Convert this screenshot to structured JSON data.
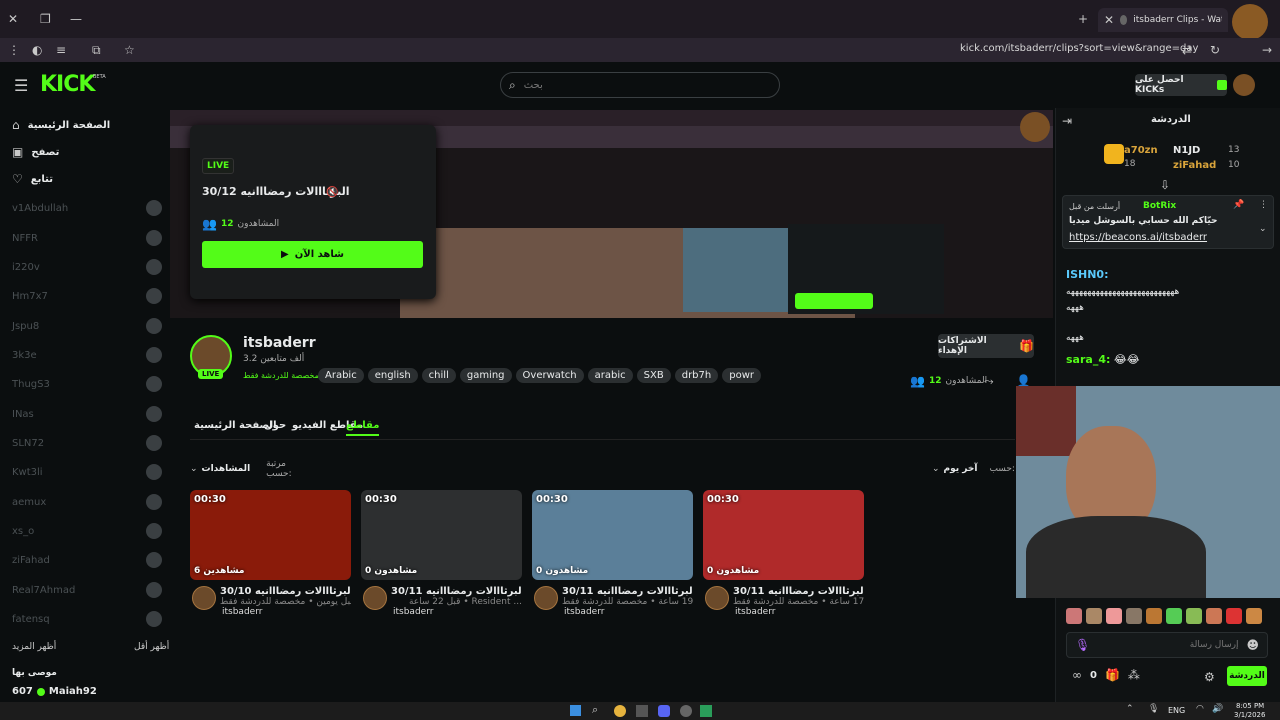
{
  "browser": {
    "tab_title": "itsbaderr Clips - Watch Live",
    "url": "kick.com/itsbaderr/clips?sort=view&range=day"
  },
  "header": {
    "logo": "KICK",
    "beta": "BETA",
    "search_placeholder": "بحث",
    "get_kicks": "احصل على KICKs"
  },
  "sidebar": {
    "nav": [
      {
        "label": "الصفحة الرئيسية",
        "icon": "home-icon"
      },
      {
        "label": "تصفح",
        "icon": "browse-icon"
      },
      {
        "label": "تتابع",
        "icon": "heart-icon"
      }
    ],
    "channels": [
      "v1Abdullah",
      "NFFR",
      "i220v",
      "Hm7x7",
      "Jspu8",
      "3k3e",
      "ThugS3",
      "INas",
      "SLN72",
      "Kwt3li",
      "aemux",
      "xs_o",
      "ziFahad",
      "Real7Ahmad",
      "fatensq"
    ],
    "show_more": "أظهر المزيد",
    "show_less": "أظهر أقل",
    "recommended_title": "موصى بها",
    "recommended_item": {
      "count": "607",
      "name": "Maiah92"
    }
  },
  "popup": {
    "live": "LIVE",
    "title": "البرثااالات رمضااانيه 30/12",
    "viewers_label": "المشاهدون",
    "viewers": "12",
    "watch_now": "شاهد الآن"
  },
  "channel": {
    "name": "itsbaderr",
    "followers": "3.2 ألف متابعين",
    "chat_only": "مخصصة للدردشة فقط",
    "live": "LIVE",
    "tags": [
      "Arabic",
      "english",
      "chill",
      "gaming",
      "Overwatch",
      "arabic",
      "SXB",
      "drb7h",
      "powr"
    ],
    "gift_subs": "الاشتراكات الإهداء",
    "viewers_label": "المشاهدون",
    "viewers": "12"
  },
  "tabs": [
    "مقاطع",
    "مقاطع الفيديو",
    "حول",
    "الصفحة الرئيسية"
  ],
  "filters": {
    "sort_label": "مرتبة حسب:",
    "sort_value": "المشاهدات",
    "range_label": "حسب:",
    "range_value": "آخر يوم"
  },
  "clips": [
    {
      "duration": "00:30",
      "views": "6 مشاهدين",
      "title": "البرثااالات رمضااانيه 30/10",
      "meta": "قبل يومين • مخصصة للدردشة فقط",
      "user": "itsbaderr"
    },
    {
      "duration": "00:30",
      "views": "0 مشاهدون",
      "title": "البرثااالات رمضااانيه 30/11",
      "meta": "قبل 22 ساعة • Resident ...",
      "user": "itsbaderr"
    },
    {
      "duration": "00:30",
      "views": "0 مشاهدون",
      "title": "البرثااالات رمضااانيه 30/11",
      "meta": "قبل 19 ساعة • مخصصة للدردشة فقط",
      "user": "itsbaderr"
    },
    {
      "duration": "00:30",
      "views": "0 مشاهدون",
      "title": "البرثااالات رمضااانيه 30/11",
      "meta": "قبل 17 ساعة • مخصصة للدردشة فقط",
      "user": "itsbaderr"
    }
  ],
  "chat": {
    "title": "الدردشة",
    "leaderboard": [
      {
        "rank": "13",
        "name": "N1JD"
      },
      {
        "rank": "10",
        "name": "ziFahad"
      },
      {
        "rank": "",
        "name": "a70zn"
      },
      {
        "rank": "18",
        "name": ""
      }
    ],
    "pinned": {
      "by": "أرسلت من قبل",
      "bot": "BotRix",
      "text": "حيّاكم الله حسابي بالسوشل ميديا",
      "link": "https://beacons.ai/itsbaderr"
    },
    "messages": [
      {
        "user": "ISHN0:",
        "text": "ههههههههههههههههههههههههههه"
      },
      {
        "user": "",
        "text": "هههه"
      },
      {
        "user": "",
        "text": "هههه"
      },
      {
        "user": "sara_4:",
        "text": "😂😂"
      }
    ],
    "input_placeholder": "إرسال رسالة",
    "send": "الدردشة",
    "points": "0"
  },
  "taskbar": {
    "lang": "ENG",
    "time": "8:05 PM",
    "date": "3/1/2026"
  }
}
